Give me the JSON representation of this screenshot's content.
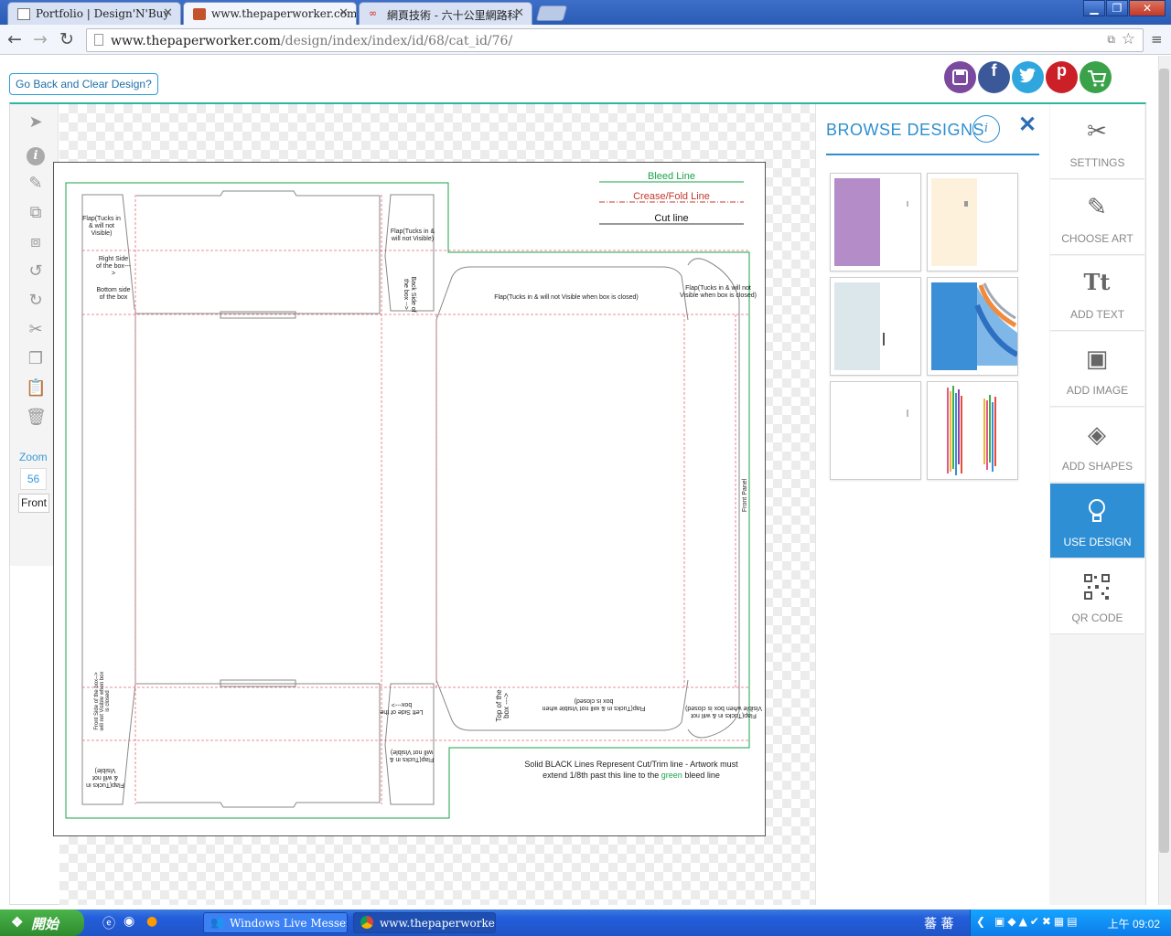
{
  "browser": {
    "tabs": [
      {
        "title": "Portfolio | Design'N'Buy"
      },
      {
        "title": "www.thepaperworker.com/de"
      },
      {
        "title": "網頁技術 - 六十公里網路科"
      }
    ],
    "url_host": "www.thepaperworker.com",
    "url_path": "/design/index/index/id/68/cat_id/76/"
  },
  "page": {
    "go_back_label": "Go Back and Clear Design?",
    "social": [
      {
        "name": "save-icon",
        "color": "#7b4a9e"
      },
      {
        "name": "facebook-icon",
        "color": "#3b5998",
        "glyph": "f"
      },
      {
        "name": "twitter-icon",
        "color": "#2fa7de"
      },
      {
        "name": "pinterest-icon",
        "color": "#cb2027",
        "glyph": "p"
      },
      {
        "name": "cart-icon",
        "color": "#3aa34a"
      }
    ]
  },
  "left_tools": {
    "icons": [
      "select-arrow-icon",
      "info-icon",
      "edit-icon",
      "bring-front-icon",
      "send-back-icon",
      "undo-icon",
      "redo-icon",
      "cut-icon",
      "copy-icon",
      "paste-icon",
      "delete-icon"
    ],
    "zoom_label": "Zoom",
    "zoom_value": "56",
    "side_select": "Front"
  },
  "template": {
    "legend_bleed": "Bleed Line",
    "legend_crease": "Crease/Fold Line",
    "legend_cut": "Cut line",
    "footnote_1": "Solid BLACK Lines Represent Cut/Trim line - Artwork must",
    "footnote_2_pre": "extend 1/8th past this line to the",
    "footnote_green": "green",
    "footnote_2_post": "bleed line",
    "labels": {
      "flap_left": "Flap(Tucks in & will not Visible)",
      "flap_right": "Flap(Tucks in & will not Visible)",
      "right_side": "Right Side of the box--->",
      "bottom_inside": "Bottom side of the box",
      "back_side": "Back Side of the box -->",
      "flap_top": "Flap(Tucks in & will not Visible when box is closed)",
      "flap_top_right": "Flap(Tucks in & will not Visible when box is closed)",
      "front_panel": "Front Panel",
      "top_of_box": "Top of the box --->",
      "flap_bottom": "Flap(Tucks in & will not Visible when box is closed)",
      "flap_bottom_right": "Flap(Tucks in & will not Visible when box is closed)",
      "left_side": "Left Side of the box--->",
      "front_side": "Front Side of the box--> will not Visible when box is closed",
      "flap_bl": "Flap(Tucks in & will not Visible)",
      "flap_br": "Flap(Tucks in & will not Visible)"
    },
    "colors": {
      "bleed": "#1aa34a",
      "crease": "#e8697a",
      "cut": "#444444"
    }
  },
  "browse": {
    "title": "BROWSE DESIGNS",
    "info_glyph": "i",
    "close_glyph": "✕",
    "designs": [
      {
        "name": "design-thumb-purple",
        "color": "#b48cc8"
      },
      {
        "name": "design-thumb-cream",
        "color": "#fdf1dc"
      },
      {
        "name": "design-thumb-pale-blue",
        "color": "#dbe7ea"
      },
      {
        "name": "design-thumb-blue-waves",
        "color": "#3a8fd6"
      },
      {
        "name": "design-thumb-blank",
        "color": "#ffffff"
      },
      {
        "name": "design-thumb-colorful",
        "color": "#e05a8a"
      }
    ]
  },
  "right_menu": [
    {
      "label": "SETTINGS",
      "icon": "settings-icon",
      "glyph": "✂"
    },
    {
      "label": "CHOOSE ART",
      "icon": "choose-art-icon",
      "glyph": "✎"
    },
    {
      "label": "ADD TEXT",
      "icon": "add-text-icon",
      "glyph": "Tt"
    },
    {
      "label": "ADD IMAGE",
      "icon": "add-image-icon",
      "glyph": "▣"
    },
    {
      "label": "ADD SHAPES",
      "icon": "add-shapes-icon",
      "glyph": "◈"
    },
    {
      "label": "USE DESIGN",
      "icon": "lightbulb-icon",
      "glyph": "💡"
    },
    {
      "label": "QR CODE",
      "icon": "qr-code-icon",
      "glyph": "▦"
    }
  ],
  "taskbar": {
    "start_label": "開始",
    "items": [
      {
        "title": "Windows Live Messen..."
      },
      {
        "title": "www.thepaperworker...."
      }
    ],
    "ime": "蕃 蕃",
    "clock": "上午 09:02"
  }
}
